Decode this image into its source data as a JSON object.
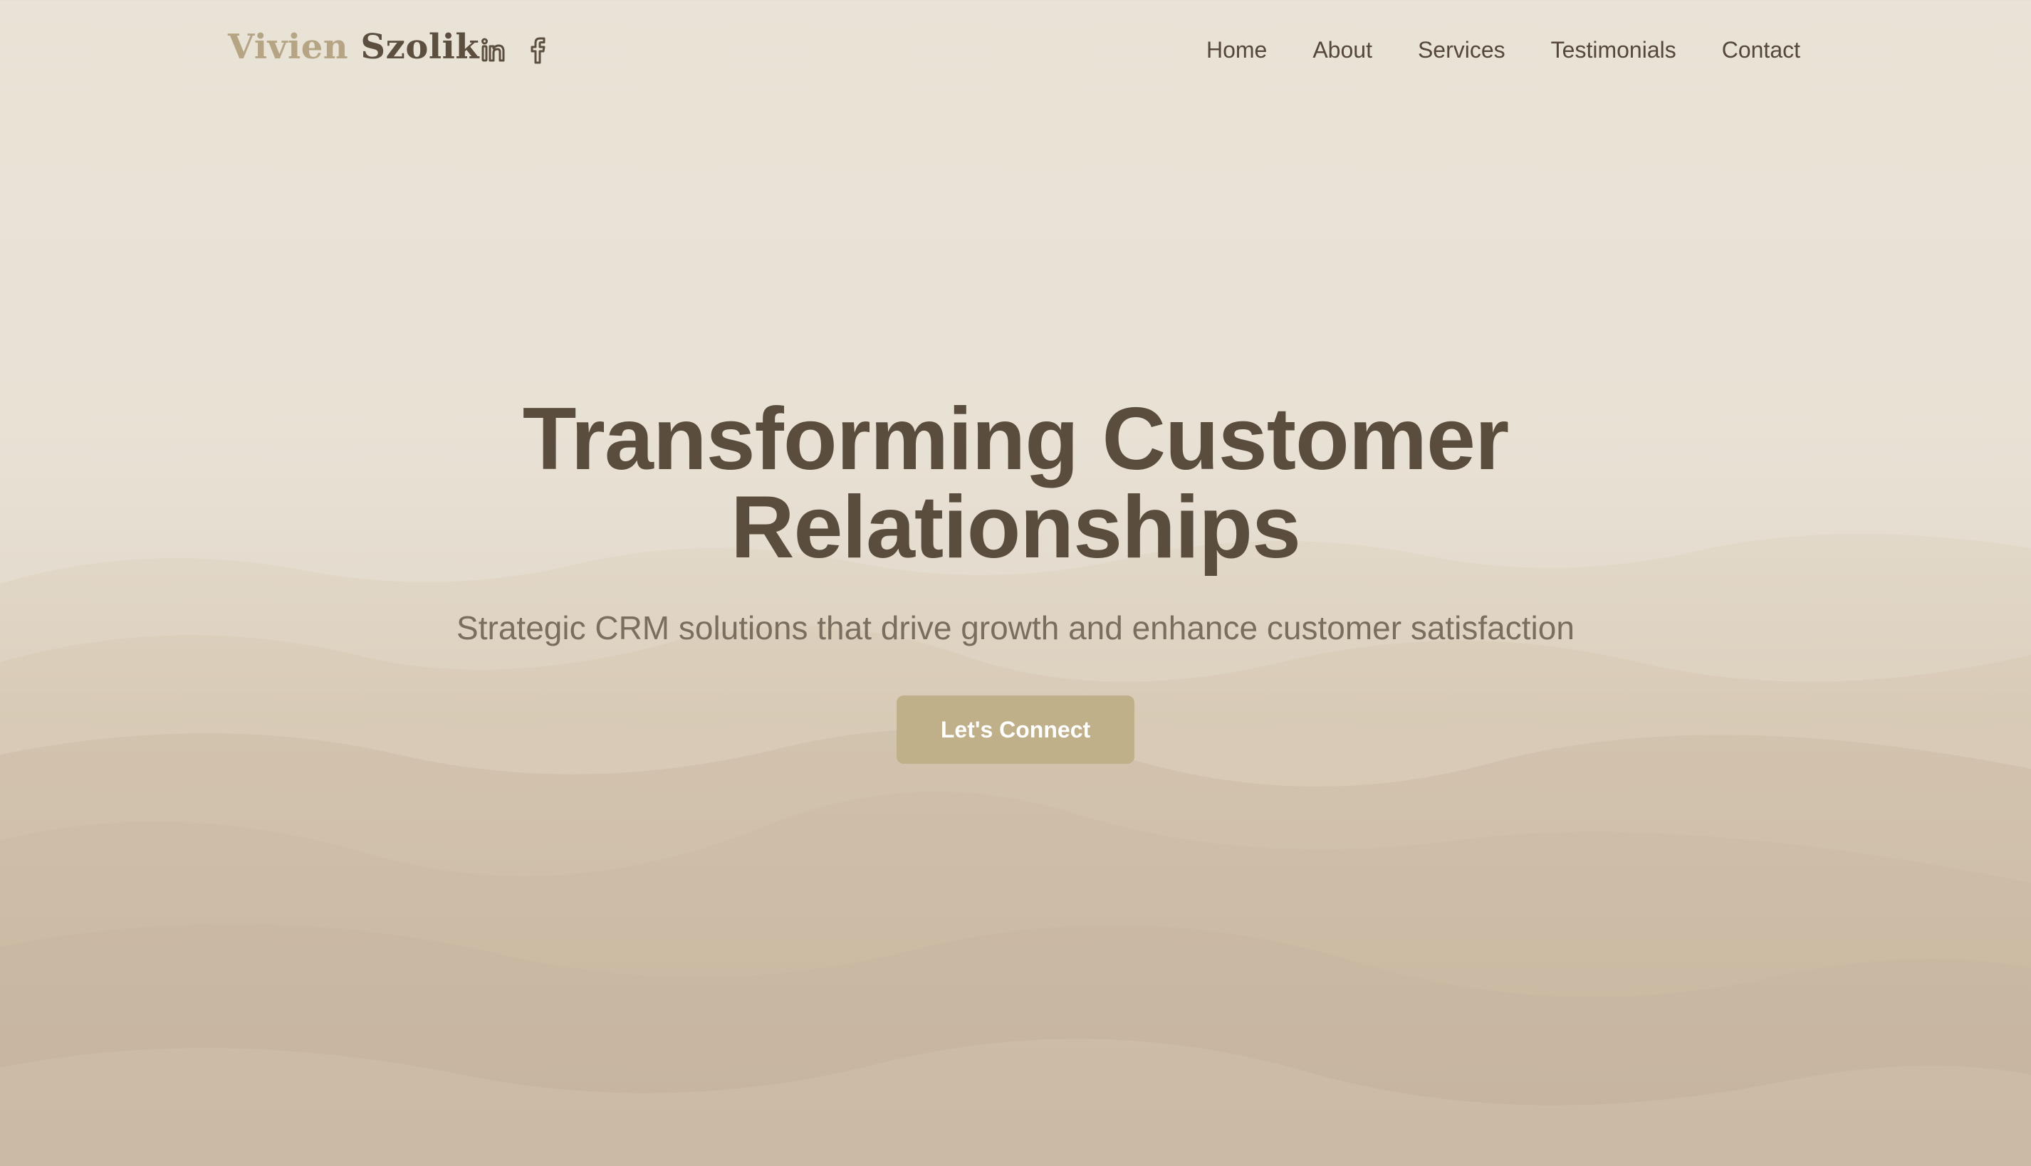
{
  "header": {
    "brand_first": "Vivien",
    "brand_last": "Szolik",
    "social": [
      {
        "icon": "linkedin-icon"
      },
      {
        "icon": "facebook-icon"
      }
    ],
    "nav": [
      "Home",
      "About",
      "Services",
      "Testimonials",
      "Contact"
    ]
  },
  "hero": {
    "title_line1": "Transforming Customer",
    "title_line2": "Relationships",
    "subtitle": "Strategic CRM solutions that drive growth and enhance customer satisfaction",
    "cta_label": "Let's Connect"
  },
  "colors": {
    "brand_accent": "#b5a584",
    "text_dark": "#5a4d3d",
    "button": "#c0b08a",
    "background": "#e8e1d4"
  }
}
